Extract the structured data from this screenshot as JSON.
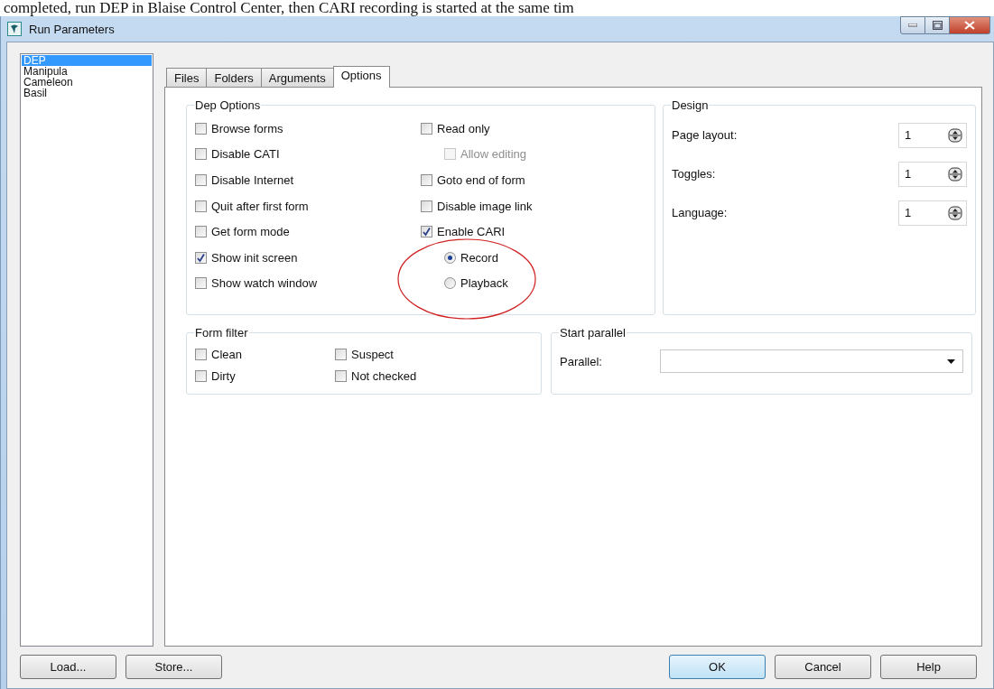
{
  "background_text": "completed, run DEP in Blaise Control Center, then CARI recording is started at the same tim",
  "window": {
    "title": "Run Parameters"
  },
  "sidebar": {
    "items": [
      {
        "label": "DEP",
        "selected": true
      },
      {
        "label": "Manipula",
        "selected": false
      },
      {
        "label": "Cameleon",
        "selected": false
      },
      {
        "label": "Basil",
        "selected": false
      }
    ]
  },
  "tabs": [
    {
      "label": "Files",
      "selected": false
    },
    {
      "label": "Folders",
      "selected": false
    },
    {
      "label": "Arguments",
      "selected": false
    },
    {
      "label": "Options",
      "selected": true
    }
  ],
  "dep_options": {
    "title": "Dep Options",
    "columns": [
      [
        {
          "label": "Browse forms",
          "checked": false
        },
        {
          "label": "Disable CATI",
          "checked": false
        },
        {
          "label": "Disable Internet",
          "checked": false
        },
        {
          "label": "Quit after first form",
          "checked": false
        },
        {
          "label": "Get form mode",
          "checked": false
        },
        {
          "label": "Show init screen",
          "checked": true
        },
        {
          "label": "Show watch window",
          "checked": false
        }
      ],
      [
        {
          "label": "Read only",
          "checked": false,
          "children": [
            {
              "kind": "checkbox",
              "label": "Allow editing",
              "checked": false,
              "disabled": true
            }
          ]
        },
        {
          "label": "Goto end of form",
          "checked": false
        },
        {
          "label": "Disable image link",
          "checked": false
        },
        {
          "label": "Enable CARI",
          "checked": true,
          "circled": true,
          "children": [
            {
              "kind": "radio",
              "label": "Record",
              "selected": true
            },
            {
              "kind": "radio",
              "label": "Playback",
              "selected": false
            }
          ]
        }
      ]
    ]
  },
  "design": {
    "title": "Design",
    "fields": [
      {
        "label": "Page layout:",
        "value": "1"
      },
      {
        "label": "Toggles:",
        "value": "1"
      },
      {
        "label": "Language:",
        "value": "1"
      }
    ]
  },
  "form_filter": {
    "title": "Form filter",
    "columns": [
      [
        {
          "label": "Clean",
          "checked": false
        },
        {
          "label": "Dirty",
          "checked": false
        }
      ],
      [
        {
          "label": "Suspect",
          "checked": false
        },
        {
          "label": "Not checked",
          "checked": false
        }
      ]
    ]
  },
  "start_parallel": {
    "title": "Start parallel",
    "label": "Parallel:"
  },
  "buttons_left": [
    {
      "label": "Load...",
      "default": false
    },
    {
      "label": "Store...",
      "default": false
    }
  ],
  "buttons_right": [
    {
      "label": "OK",
      "default": true
    },
    {
      "label": "Cancel",
      "default": false
    },
    {
      "label": "Help",
      "default": false
    }
  ]
}
